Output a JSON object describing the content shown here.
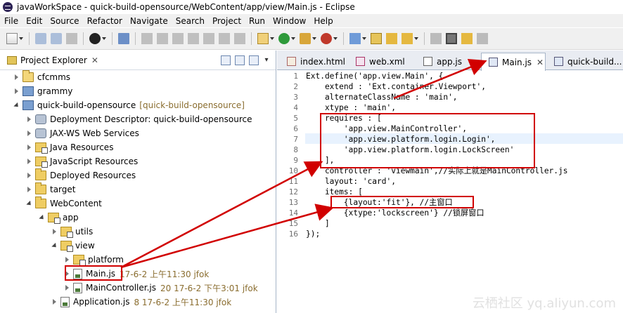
{
  "window": {
    "title": "javaWorkSpace - quick-build-opensource/WebContent/app/view/Main.js - Eclipse"
  },
  "menu": [
    "File",
    "Edit",
    "Source",
    "Refactor",
    "Navigate",
    "Search",
    "Project",
    "Run",
    "Window",
    "Help"
  ],
  "explorer": {
    "title": "Project Explorer",
    "close": "✕",
    "tree": [
      {
        "label": "cfcmms",
        "level": 0,
        "twisty": "closed",
        "icon": "project-icon"
      },
      {
        "label": "grammy",
        "level": 0,
        "twisty": "closed",
        "icon": "web-project-icon"
      },
      {
        "label": "quick-build-opensource",
        "deco": "[quick-build-opensource]",
        "level": 0,
        "twisty": "open",
        "icon": "web-project-icon"
      },
      {
        "label": "Deployment Descriptor: quick-build-opensource",
        "level": 1,
        "twisty": "closed",
        "icon": "descriptor-icon"
      },
      {
        "label": "JAX-WS Web Services",
        "level": 1,
        "twisty": "closed",
        "icon": "webservice-icon"
      },
      {
        "label": "Java Resources",
        "level": 1,
        "twisty": "closed",
        "icon": "package-icon"
      },
      {
        "label": "JavaScript Resources",
        "level": 1,
        "twisty": "closed",
        "icon": "package-icon"
      },
      {
        "label": "Deployed Resources",
        "level": 1,
        "twisty": "closed",
        "icon": "folder-icon"
      },
      {
        "label": "target",
        "level": 1,
        "twisty": "closed",
        "icon": "folder-icon"
      },
      {
        "label": "WebContent",
        "level": 1,
        "twisty": "open",
        "icon": "folder-icon"
      },
      {
        "label": "app",
        "level": 2,
        "twisty": "open",
        "icon": "package-folder-icon"
      },
      {
        "label": "utils",
        "level": 3,
        "twisty": "closed",
        "icon": "package-folder-icon"
      },
      {
        "label": "view",
        "level": 3,
        "twisty": "open",
        "icon": "package-folder-icon"
      },
      {
        "label": "platform",
        "level": 4,
        "twisty": "closed",
        "icon": "package-folder-icon"
      },
      {
        "label": "Main.js",
        "meta": "17-6-2 上午11:30  jfok",
        "level": 4,
        "twisty": "closed",
        "icon": "js-file-icon"
      },
      {
        "label": "MainController.js",
        "meta": "20  17-6-2 下午3:01  jfok",
        "level": 4,
        "twisty": "closed",
        "icon": "js-file-icon"
      },
      {
        "label": "Application.js",
        "meta": "8  17-6-2 上午11:30  jfok",
        "level": 2,
        "twisty": "closed",
        "icon": "js-file-icon"
      }
    ]
  },
  "tabs": [
    {
      "label": "index.html",
      "icon": "html-file-icon",
      "active": false
    },
    {
      "label": "web.xml",
      "icon": "xml-file-icon",
      "active": false
    },
    {
      "label": "app.js",
      "icon": "js-file-icon",
      "active": false
    },
    {
      "label": "Main.js",
      "icon": "js-file-icon",
      "active": true,
      "close": "✕"
    },
    {
      "label": "quick-build...",
      "icon": "js-file-icon",
      "active": false
    }
  ],
  "code": {
    "lines": [
      {
        "n": "1",
        "t": "Ext.define('app.view.Main', {"
      },
      {
        "n": "2",
        "t": "    extend : 'Ext.container.Viewport',"
      },
      {
        "n": "3",
        "t": "    alternateClassName : 'main',"
      },
      {
        "n": "4",
        "t": "    xtype : 'main',"
      },
      {
        "n": "5",
        "t": "    requires : ["
      },
      {
        "n": "6",
        "t": "        'app.view.MainController',"
      },
      {
        "n": "7",
        "t": "        'app.view.platform.login.Login',"
      },
      {
        "n": "8",
        "t": "        'app.view.platform.login.LockScreen'"
      },
      {
        "n": "9",
        "t": "    ],"
      },
      {
        "n": "10",
        "t": "    controller : 'viewmain',//实际上就是MainController.js"
      },
      {
        "n": "11",
        "t": "    layout: 'card',"
      },
      {
        "n": "12",
        "t": "    items: ["
      },
      {
        "n": "13",
        "t": "        {layout:'fit'}, //主窗口"
      },
      {
        "n": "14",
        "t": "        {xtype:'lockscreen'} //锁屏窗口"
      },
      {
        "n": "15",
        "t": "    ]"
      },
      {
        "n": "16",
        "t": "});"
      }
    ]
  },
  "watermark": "云栖社区 yq.aliyun.com",
  "colors": {
    "annotation": "#d10000",
    "string": "#2a00ff",
    "comment": "#3f7f5f"
  }
}
